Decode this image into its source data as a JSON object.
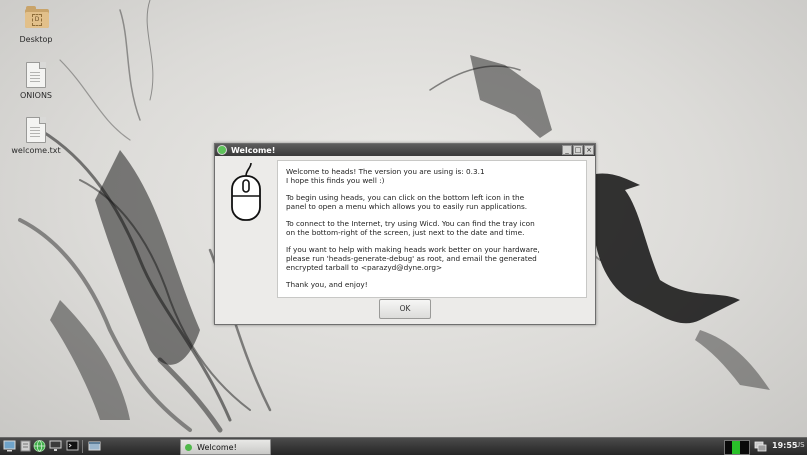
{
  "desktop": {
    "icons": [
      {
        "label": "Desktop",
        "icon": "folder-icon"
      },
      {
        "label": "ONIONS",
        "icon": "text-file-icon"
      },
      {
        "label": "welcome.txt",
        "icon": "text-file-icon"
      }
    ]
  },
  "dialog": {
    "title": "Welcome!",
    "controls": {
      "minimize": "_",
      "maximize": "□",
      "close": "×"
    },
    "icon": "mouse-icon",
    "paragraphs": [
      "Welcome to heads! The version you are using is: 0.3.1\nI hope this finds you well :)",
      "To begin using heads, you can click on the bottom left icon in the\npanel to open a menu which allows you to easily run applications.",
      "To connect to the Internet, try using Wicd.  You can find the tray icon\non the bottom-right of the screen, just next to the date and time.",
      "If you want to help with making heads work better on your hardware,\nplease run 'heads-generate-debug' as root, and email the generated\nencrypted tarball to <parazyd@dyne.org>",
      "Thank you, and enjoy!"
    ],
    "ok_label": "OK"
  },
  "taskbar": {
    "launchers": [
      "monitor-icon",
      "file-manager-icon",
      "globe-icon",
      "desktop-icon",
      "terminal-icon",
      "window-icon"
    ],
    "tasks": [
      {
        "label": "Welcome!"
      }
    ],
    "tray": {
      "network": "network-icon",
      "cpu_load": 1.0
    },
    "clock": "19:55",
    "keyboard_layout": "US"
  },
  "colors": {
    "accent": "#4fb84a",
    "titlebar": "#4a4a4a",
    "panel": "#333333"
  }
}
